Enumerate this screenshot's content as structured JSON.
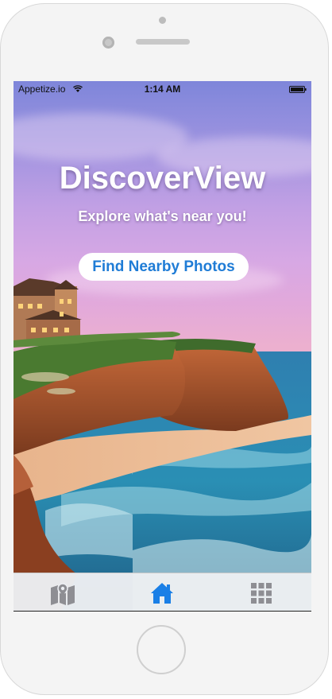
{
  "status_bar": {
    "carrier": "Appetize.io",
    "time": "1:14 AM"
  },
  "hero": {
    "title": "DiscoverView",
    "subtitle": "Explore what's near you!",
    "button_label": "Find Nearby Photos"
  },
  "tab_bar": {
    "items": [
      {
        "icon": "map-icon",
        "selected": false
      },
      {
        "icon": "home-icon",
        "selected": true
      },
      {
        "icon": "grid-icon",
        "selected": false
      }
    ],
    "active_color": "#1a7fe6",
    "inactive_color": "#8e8e93"
  },
  "colors": {
    "button_text": "#1f7cd6",
    "title_text": "#ffffff"
  }
}
